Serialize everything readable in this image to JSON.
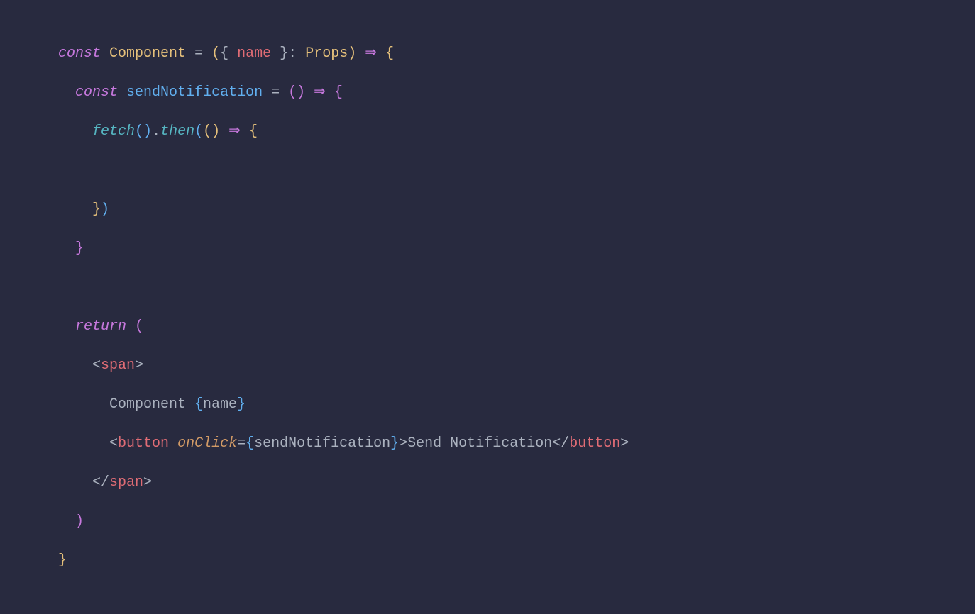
{
  "code": {
    "const1": "const",
    "component": "Component",
    "eq1": " = ",
    "name_param": "name",
    "props_type": "Props",
    "arrow1": "⇒",
    "const2": "const",
    "sendNotif": "sendNotification",
    "eq2": " = ",
    "arrow2": "⇒",
    "fetch": "fetch",
    "then": "then",
    "arrow3": "⇒",
    "return": "return",
    "span_tag": "span",
    "jsx_text": "      Component ",
    "name_expr": "name",
    "button_tag": "button",
    "onClick_attr": "onClick",
    "sendNotif_ref": "sendNotification",
    "button_text": "Send Notification"
  }
}
